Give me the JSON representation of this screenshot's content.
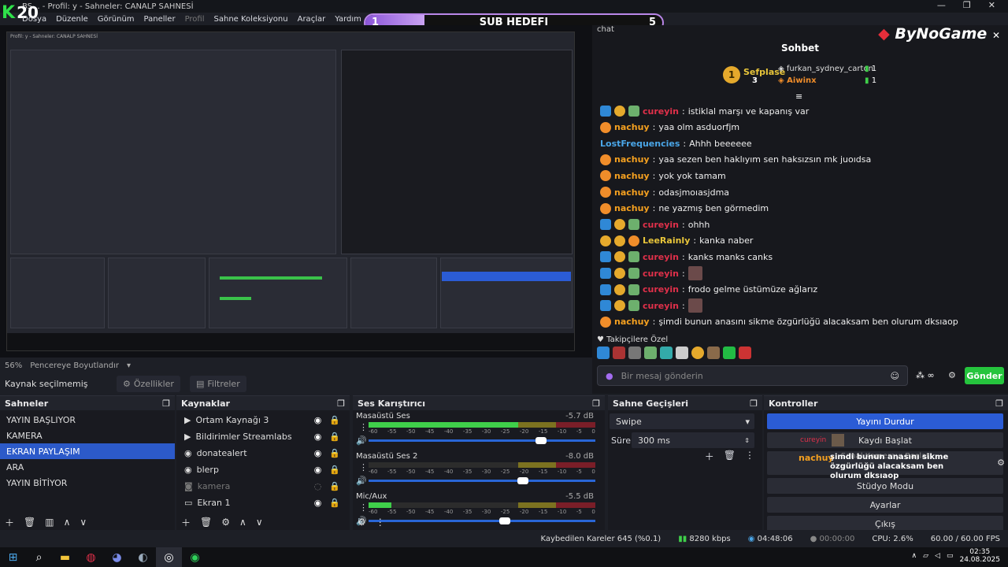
{
  "window": {
    "title": "BS... - Profil: y - Sahneler: CANALP SAHNESİ",
    "menu": [
      "Dosya",
      "Düzenle",
      "Görünüm",
      "Paneller",
      "Profil",
      "Sahne Koleksiyonu",
      "Araçlar",
      "Yardım"
    ],
    "logo_text": "20"
  },
  "sub_goal": {
    "current": "1",
    "target": "5",
    "label": "SUB HEDEFI",
    "progress": 0.2
  },
  "preview": {
    "zoom": "56%",
    "fit": "Pencereye Boyutlandır",
    "mini_title": "Profil: y - Sahneler: CANALP SAHNESİ"
  },
  "source_bar": {
    "status": "Kaynak seçilmemiş",
    "properties": "Özellikler",
    "filters": "Filtreler"
  },
  "chat": {
    "header": "chat",
    "brand": "ByNoGame",
    "title": "Sohbet",
    "leaderboard": {
      "first": {
        "rank": "1",
        "name": "Sefplase",
        "count": "3"
      },
      "second": {
        "name": "furkan_sydney_carton",
        "count": "1"
      },
      "third": {
        "name": "Aiwinx",
        "count": "1"
      }
    },
    "messages": [
      {
        "user": "cureyin",
        "color": "#e0304a",
        "text": "istiklal marşı ve kapanış var",
        "badges": [
          "blue",
          "gold",
          "green"
        ]
      },
      {
        "user": "nachuy",
        "color": "#f4a020",
        "text": "yaa olm asduorfjm",
        "badges": [
          "fire"
        ]
      },
      {
        "user": "LostFrequencies",
        "color": "#4aa6e8",
        "text": "Ahhh beeeeee",
        "badges": []
      },
      {
        "user": "nachuy",
        "color": "#f4a020",
        "text": "yaa sezen ben haklıyım sen haksızsın mk juoıdsa",
        "badges": [
          "fire"
        ]
      },
      {
        "user": "nachuy",
        "color": "#f4a020",
        "text": "yok yok tamam",
        "badges": [
          "fire"
        ]
      },
      {
        "user": "nachuy",
        "color": "#f4a020",
        "text": "odasjmoıasjdma",
        "badges": [
          "fire"
        ]
      },
      {
        "user": "nachuy",
        "color": "#f4a020",
        "text": "ne yazmış ben görmedim",
        "badges": [
          "fire"
        ]
      },
      {
        "user": "cureyin",
        "color": "#e0304a",
        "text": "ohhh",
        "badges": [
          "blue",
          "gold",
          "green"
        ]
      },
      {
        "user": "LeeRainly",
        "color": "#e8c53a",
        "text": "kanka naber",
        "badges": [
          "gold",
          "gold",
          "fire"
        ]
      },
      {
        "user": "cureyin",
        "color": "#e0304a",
        "text": "kanks manks canks",
        "badges": [
          "blue",
          "gold",
          "green"
        ]
      },
      {
        "user": "cureyin",
        "color": "#e0304a",
        "text": "",
        "badges": [
          "blue",
          "gold",
          "green"
        ],
        "thumb": true
      },
      {
        "user": "cureyin",
        "color": "#e0304a",
        "text": "frodo gelme üstümüze ağlarız",
        "badges": [
          "blue",
          "gold",
          "green"
        ]
      },
      {
        "user": "cureyin",
        "color": "#e0304a",
        "text": "",
        "badges": [
          "blue",
          "gold",
          "green"
        ],
        "thumb": true
      },
      {
        "user": "nachuy",
        "color": "#f4a020",
        "text": "şimdi bunun anasını sikme özgürlüğü alacaksam ben olurum dksıaop",
        "badges": [
          "fire"
        ]
      }
    ],
    "followers_label": "Takipçilere Özel",
    "input_placeholder": "Bir mesaj gönderin",
    "send_label": "Gönder",
    "emoji_count": "∞"
  },
  "scenes": {
    "title": "Sahneler",
    "items": [
      "YAYIN BAŞLIYOR",
      "KAMERA",
      "EKRAN PAYLAŞIM",
      "ARA",
      "YAYIN BİTİYOR"
    ],
    "selected": 2
  },
  "sources": {
    "title": "Kaynaklar",
    "items": [
      {
        "name": "Ortam Kaynağı 3",
        "icon": "play-icon",
        "dim": false
      },
      {
        "name": "Bildirimler Streamlabs",
        "icon": "play-icon",
        "dim": false
      },
      {
        "name": "donatealert",
        "icon": "globe-icon",
        "dim": false
      },
      {
        "name": "blerp",
        "icon": "globe-icon",
        "dim": false
      },
      {
        "name": "kamera",
        "icon": "camera-icon",
        "dim": true
      },
      {
        "name": "Ekran 1",
        "icon": "monitor-icon",
        "dim": false
      }
    ]
  },
  "mixer": {
    "title": "Ses Karıştırıcı",
    "channels": [
      {
        "name": "Masaüstü Ses",
        "db": "-5.7 dB",
        "level": 0.78,
        "volume": 0.76
      },
      {
        "name": "Masaüstü Ses 2",
        "db": "-8.0 dB",
        "level": 0.0,
        "volume": 0.68
      },
      {
        "name": "Mic/Aux",
        "db": "-5.5 dB",
        "level": 0.1,
        "volume": 0.6
      }
    ],
    "ticks": [
      "-60",
      "-55",
      "-50",
      "-45",
      "-40",
      "-35",
      "-30",
      "-25",
      "-20",
      "-15",
      "-10",
      "-5",
      "0"
    ]
  },
  "transitions": {
    "title": "Sahne Geçişleri",
    "type": "Swipe",
    "duration_label": "Süre",
    "duration": "300 ms"
  },
  "controls": {
    "title": "Kontroller",
    "stop_stream": "Yayını Durdur",
    "start_record": "Kaydı Başlat",
    "virtual_cam": "Sanal Kamerayı Başlat",
    "studio_mode": "Stüdyo Modu",
    "settings": "Ayarlar",
    "exit": "Çıkış",
    "overlay_user": "nachuy",
    "overlay_text": "şimdi bunun anasını sikme özgürlüğü alacaksam ben olurum dksıaop",
    "overlay_user2": "cureyin"
  },
  "statusbar": {
    "dropped": "Kaybedilen Kareler 645 (%0.1)",
    "bitrate": "8280 kbps",
    "stream_time": "04:48:06",
    "rec_time": "00:00:00",
    "cpu": "CPU: 2.6%",
    "fps": "60.00 / 60.00 FPS"
  },
  "taskbar": {
    "time": "02:35",
    "date": "24.08.2025"
  },
  "colors": {
    "accent": "#2c5ac9",
    "send": "#25c43d",
    "brand_red": "#e52e3a",
    "goal_purple": "#b986e8"
  }
}
